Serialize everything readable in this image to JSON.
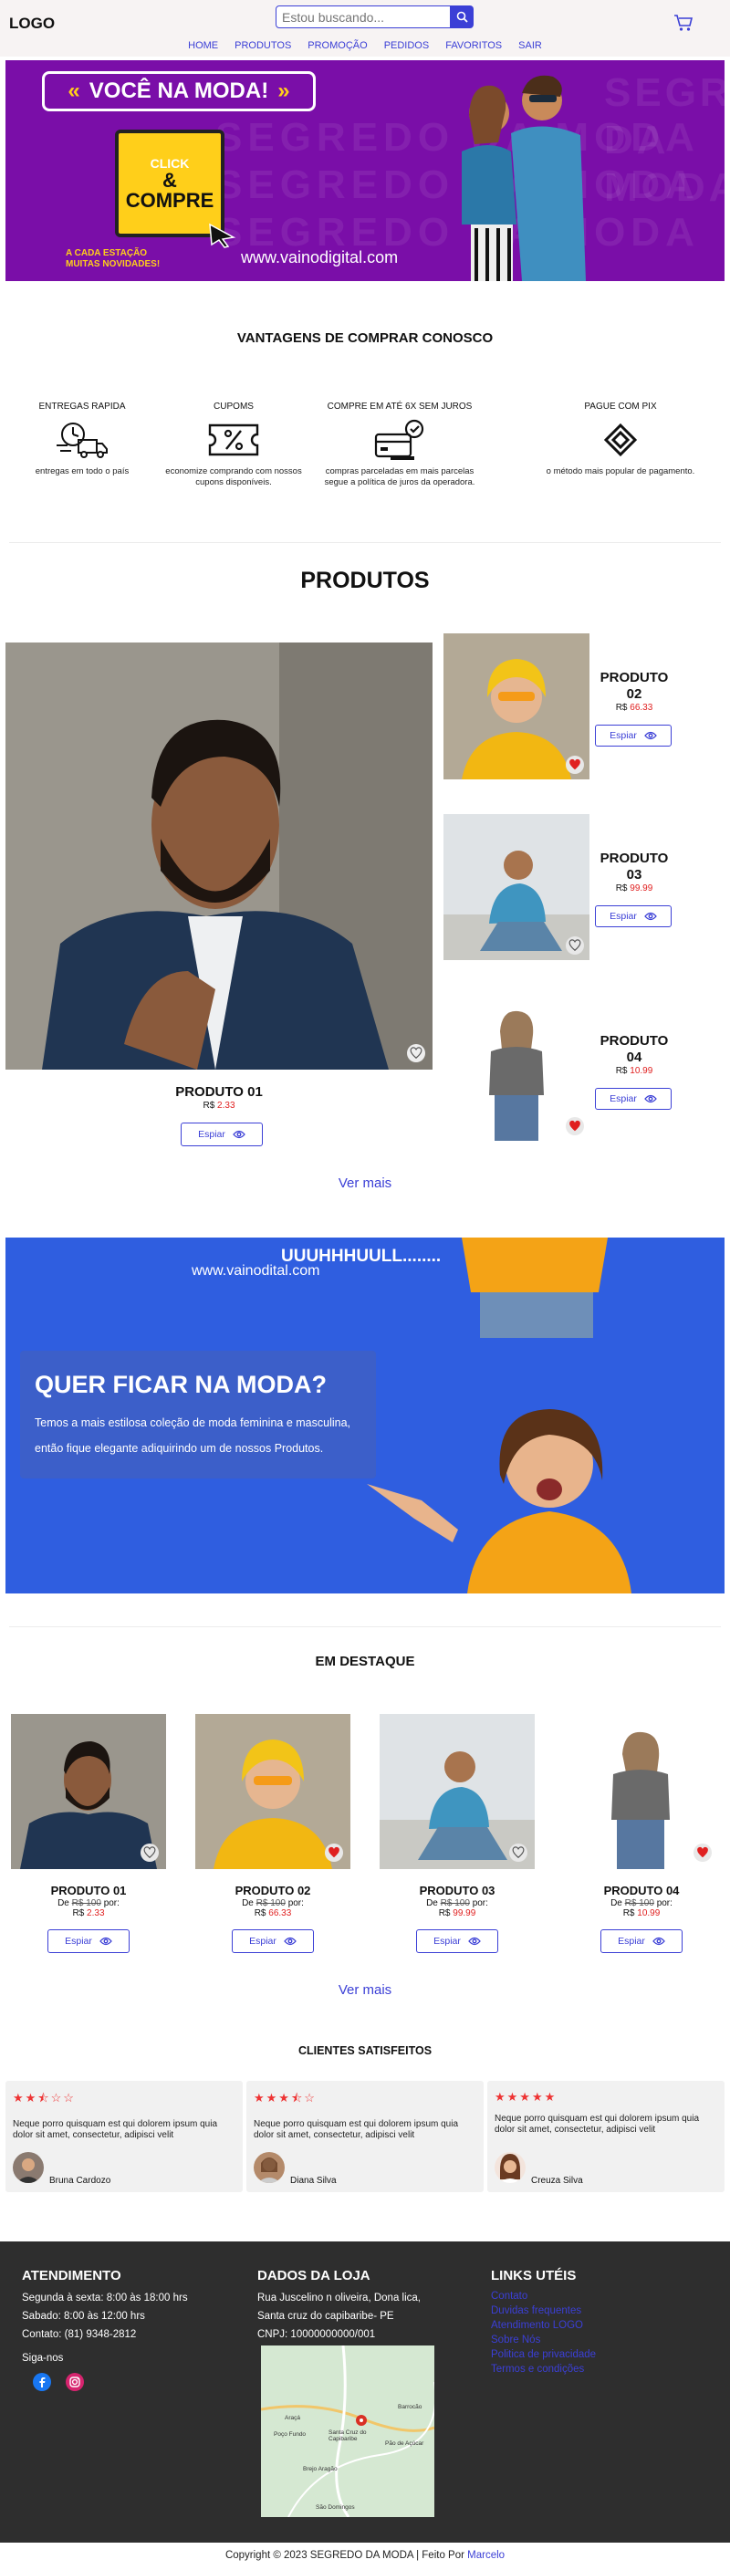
{
  "header": {
    "logo": "LOGO",
    "search_placeholder": "Estou buscando...",
    "nav": [
      "HOME",
      "PRODUTOS",
      "PROMOÇÃO",
      "PEDIDOS",
      "FAVORITOS",
      "SAIR"
    ]
  },
  "banner": {
    "title": "VOCÊ NA MODA!",
    "watermark": "SEGREDO DA MODA",
    "bag_line1": "CLICK",
    "bag_line2": "&",
    "bag_line3": "COMPRE",
    "subtitle_1": "A CADA ESTAÇÃO",
    "subtitle_2": "MUITAS NOVIDADES!",
    "url": "www.vainodigital.com"
  },
  "advantages": {
    "title": "VANTAGENS DE COMPRAR CONOSCO",
    "items": [
      {
        "title": "ENTREGAS RAPIDA",
        "desc": "entregas em todo o país",
        "icon": "delivery-truck-icon"
      },
      {
        "title": "CUPOMS",
        "desc": "economize comprando com nossos cupons disponíveis.",
        "icon": "coupon-icon"
      },
      {
        "title": "COMPRE EM ATÉ 6X SEM JUROS",
        "desc": "compras parceladas em mais parcelas segue a política de juros da operadora.",
        "icon": "installments-icon"
      },
      {
        "title": "PAGUE COM PIX",
        "desc": "o método mais popular de pagamento.",
        "icon": "pix-icon"
      }
    ]
  },
  "produtos": {
    "title": "PRODUTOS",
    "main": {
      "name": "PRODUTO 01",
      "currency": "R$",
      "price": "2.33",
      "button": "Espiar"
    },
    "side": [
      {
        "name": "PRODUTO 02",
        "currency": "R$",
        "price": "66.33",
        "button": "Espiar",
        "favorited": true
      },
      {
        "name": "PRODUTO 03",
        "currency": "R$",
        "price": "99.99",
        "button": "Espiar",
        "favorited": false
      },
      {
        "name": "PRODUTO 04",
        "currency": "R$",
        "price": "10.99",
        "button": "Espiar",
        "favorited": true
      }
    ],
    "more": "Ver mais"
  },
  "promo": {
    "shout": "UUUHHHUULL........",
    "url": "www.vainodital.com",
    "title": "QUER FICAR NA MODA?",
    "line1": "Temos a mais estilosa coleção de moda feminina e masculina,",
    "line2": "então fique elegante adiquirindo um de nossos Produtos."
  },
  "destaque": {
    "title": "EM DESTAQUE",
    "from_label": "De",
    "old_price": "R$ 100",
    "to_label": "por:",
    "items": [
      {
        "name": "PRODUTO 01",
        "currency": "R$",
        "price": "2.33",
        "button": "Espiar",
        "favorited": false
      },
      {
        "name": "PRODUTO 02",
        "currency": "R$",
        "price": "66.33",
        "button": "Espiar",
        "favorited": true
      },
      {
        "name": "PRODUTO 03",
        "currency": "R$",
        "price": "99.99",
        "button": "Espiar",
        "favorited": false
      },
      {
        "name": "PRODUTO 04",
        "currency": "R$",
        "price": "10.99",
        "button": "Espiar",
        "favorited": true
      }
    ],
    "more": "Ver mais"
  },
  "reviews": {
    "title": "CLIENTES SATISFEITOS",
    "items": [
      {
        "stars": 2.5,
        "text": "Neque porro quisquam est qui dolorem ipsum quia dolor sit amet, consectetur, adipisci velit",
        "name": "Bruna Cardozo"
      },
      {
        "stars": 3.5,
        "text": "Neque porro quisquam est qui dolorem ipsum quia dolor sit amet, consectetur, adipisci velit",
        "name": "Diana Silva"
      },
      {
        "stars": 5,
        "text": "Neque porro quisquam est qui dolorem ipsum quia dolor sit amet, consectetur, adipisci velit",
        "name": "Creuza Silva"
      }
    ]
  },
  "footer": {
    "atendimento": {
      "title": "ATENDIMENTO",
      "lines": [
        "Segunda à sexta: 8:00 às 18:00 hrs",
        "Sabado: 8:00 às 12:00 hrs",
        "Contato: (81) 9348-2812"
      ],
      "follow": "Siga-nos"
    },
    "loja": {
      "title": "DADOS DA LOJA",
      "lines": [
        "Rua Juscelino n oliveira, Dona lica,",
        "Santa cruz do capibaribe- PE",
        "CNPJ: 10000000000/001"
      ],
      "map_labels": [
        "Santa Cruz do Capibaribe",
        "Araçá",
        "Poço Fundo",
        "Brejo Aragão",
        "São Domingos",
        "Pão de Açúcar",
        "Barrocão"
      ]
    },
    "links": {
      "title": "LINKS UTÉIS",
      "items": [
        "Contato",
        "Duvidas frequentes",
        "Atendimento LOGO",
        "Sobre Nós",
        "Politica de privacidade",
        "Termos e condições"
      ]
    }
  },
  "copyright": {
    "text": "Copyright © 2023 SEGREDO DA MODA | Feito Por",
    "author": "Marcelo"
  },
  "colors": {
    "accent": "#3b3fd6",
    "banner": "#7a0ea8",
    "promo": "#2f5ee0",
    "price": "#e02020",
    "footer": "#2e2e2e"
  }
}
